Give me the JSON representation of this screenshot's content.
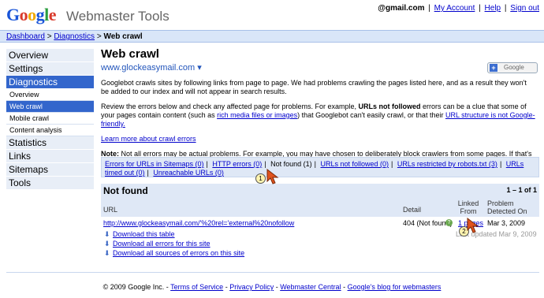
{
  "header": {
    "logo": "Google",
    "product": "Webmaster Tools",
    "account_email": "@gmail.com",
    "links": [
      "My Account",
      "Help",
      "Sign out"
    ]
  },
  "breadcrumb": {
    "items": [
      "Dashboard",
      "Diagnostics"
    ],
    "current": "Web crawl"
  },
  "sidebar": {
    "items": [
      {
        "label": "Overview"
      },
      {
        "label": "Settings"
      },
      {
        "label": "Diagnostics",
        "active": true
      },
      {
        "label": "Statistics"
      },
      {
        "label": "Links"
      },
      {
        "label": "Sitemaps"
      },
      {
        "label": "Tools"
      }
    ],
    "subitems": [
      {
        "label": "Overview"
      },
      {
        "label": "Web crawl",
        "active": true
      },
      {
        "label": "Mobile crawl"
      },
      {
        "label": "Content analysis"
      }
    ]
  },
  "main": {
    "title": "Web crawl",
    "site": "www.glockeasymail.com",
    "site_arrow": "▾",
    "add_google_button": "Google",
    "intro": "Googlebot crawls sites by following links from page to page. We had problems crawling the pages listed here, and as a result they won't be added to our index and will not appear in search results.",
    "review_1": "Review the errors below and check any affected page for problems. For example, ",
    "review_bold": "URLs not followed",
    "review_2": " errors can be a clue that some of your pages contain content (such as ",
    "review_link1": "rich media files or images",
    "review_3": ") that Googlebot can't easily crawl, or that their ",
    "review_link2": "URL structure is not Google-friendly.",
    "learn_more": "Learn more about crawl errors",
    "note_label": "Note:",
    "note_text": " Not all errors may be actual problems. For example, you may have chosen to deliberately block crawlers from some pages. If that's the case, there's no need to fix the error."
  },
  "error_tabs": [
    {
      "label": "Errors for URLs in Sitemaps (0)",
      "link": true
    },
    {
      "label": "HTTP errors (0)",
      "link": true
    },
    {
      "label": "Not found (1)",
      "link": false
    },
    {
      "label": "URLs not followed (0)",
      "link": true
    },
    {
      "label": "URLs restricted by robots.txt (3)",
      "link": true
    },
    {
      "label": "URLs timed out (0)",
      "link": true
    },
    {
      "label": "Unreachable URLs (0)",
      "link": true
    }
  ],
  "table": {
    "title": "Not found",
    "count": "1 – 1 of 1",
    "columns": {
      "url": "URL",
      "detail": "Detail",
      "linked_from": "Linked From",
      "detected": "Problem Detected On"
    },
    "rows": [
      {
        "url": "http://www.glockeasymail.com/'%20rel='external%20nofollow",
        "detail": "404 (Not found)",
        "linked_from": "1 pages",
        "detected": "Mar 3, 2009"
      }
    ],
    "last_updated": "Last updated Mar 9, 2009"
  },
  "downloads": [
    "Download this table",
    "Download all errors for this site",
    "Download all sources of errors on this site"
  ],
  "callouts": [
    "1",
    "2"
  ],
  "footer": {
    "copyright": "© 2009 Google Inc. - ",
    "links": [
      "Terms of Service",
      "Privacy Policy",
      "Webmaster Central",
      "Google's blog for webmasters"
    ]
  },
  "colors": {
    "nav_active": "#3366cc",
    "nav_bg": "#e8eef7",
    "crumb_bg": "#d9e6f8",
    "table_bg": "#dfe8f6",
    "cursor": "#e0531d"
  }
}
